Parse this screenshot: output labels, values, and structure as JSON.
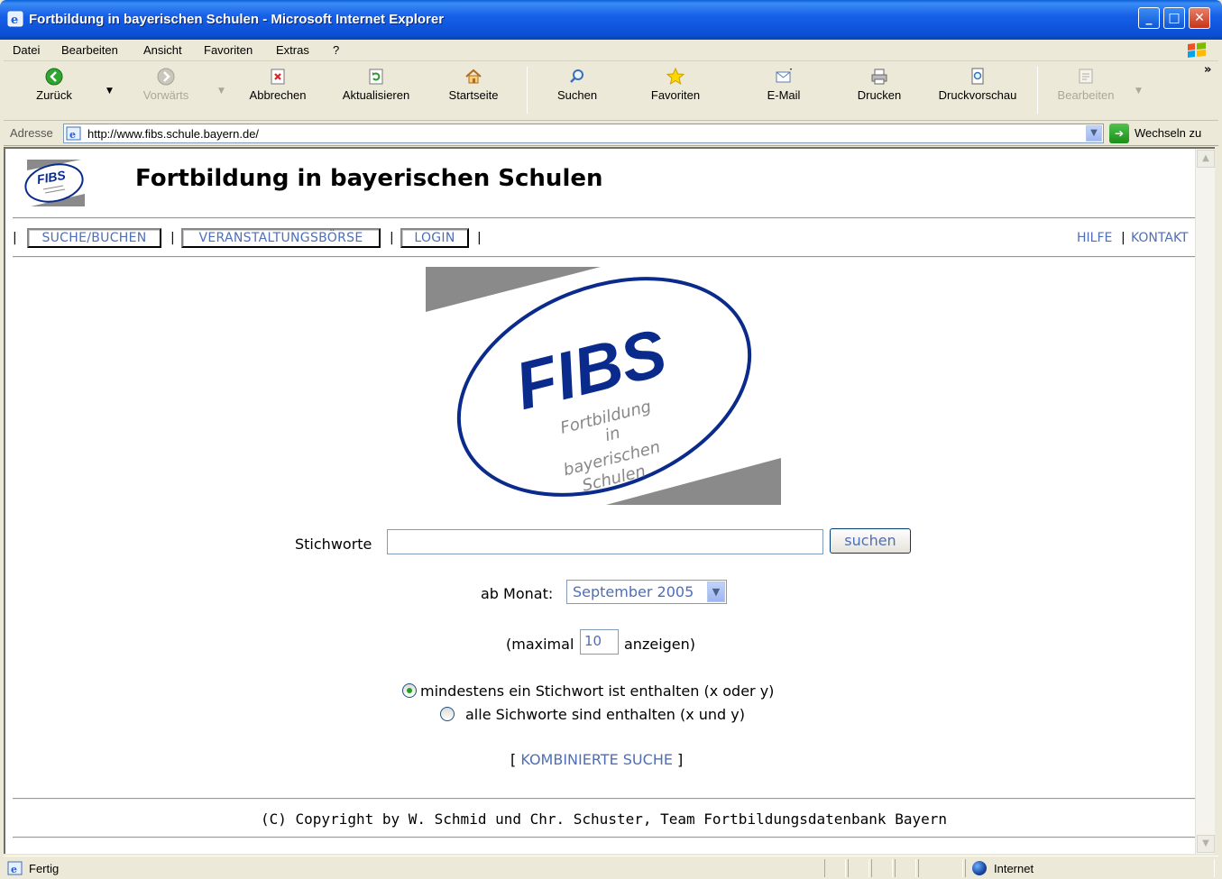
{
  "window": {
    "title": "Fortbildung in bayerischen Schulen - Microsoft Internet Explorer",
    "controls": {
      "minimize": "_",
      "maximize": "□",
      "close": "✕"
    }
  },
  "menu": [
    "Datei",
    "Bearbeiten",
    "Ansicht",
    "Favoriten",
    "Extras",
    "?"
  ],
  "toolbar": {
    "back": "Zurück",
    "forward": "Vorwärts",
    "stop": "Abbrechen",
    "refresh": "Aktualisieren",
    "home": "Startseite",
    "search": "Suchen",
    "favorites": "Favoriten",
    "mail": "E-Mail",
    "print": "Drucken",
    "print_preview": "Druckvorschau",
    "edit": "Bearbeiten",
    "more": "»"
  },
  "address": {
    "label": "Adresse",
    "url": "http://www.fibs.schule.bayern.de/",
    "go_label": "Wechseln zu"
  },
  "page": {
    "header_title": "Fortbildung in bayerischen Schulen",
    "logo": {
      "text": "FIBS",
      "subtitle_lines": [
        "Fortbildung",
        "in",
        "bayerischen",
        "Schulen"
      ],
      "primary_color": "#0a2b8c",
      "accent_color": "#8a8a8a"
    },
    "nav": {
      "search_book": "SUCHE/BUCHEN",
      "events": "VERANSTALTUNGSBÖRSE",
      "login": "LOGIN",
      "help": "HILFE",
      "contact": "KONTAKT",
      "separator": "|"
    },
    "search": {
      "keywords_label": "Stichworte",
      "keywords_value": "",
      "search_button": "suchen",
      "month_label": "ab Monat:",
      "month_value": "September 2005",
      "max_prefix": "(maximal",
      "max_value": "10",
      "max_suffix": "anzeigen)",
      "radio_any": "mindestens ein Stichwort ist enthalten (x oder y)",
      "radio_all": "alle Sichworte sind enthalten (x und y)",
      "radio_any_checked": true,
      "combined_open": "[",
      "combined_link": "KOMBINIERTE SUCHE",
      "combined_close": "]"
    },
    "footer": "(C) Copyright by W. Schmid und Chr. Schuster, Team Fortbildungsdatenbank Bayern"
  },
  "status": {
    "text": "Fertig",
    "zone": "Internet"
  },
  "colors": {
    "link": "#4f6eb6",
    "titlebar": "#0b4fd3",
    "chrome": "#ece9d8"
  }
}
